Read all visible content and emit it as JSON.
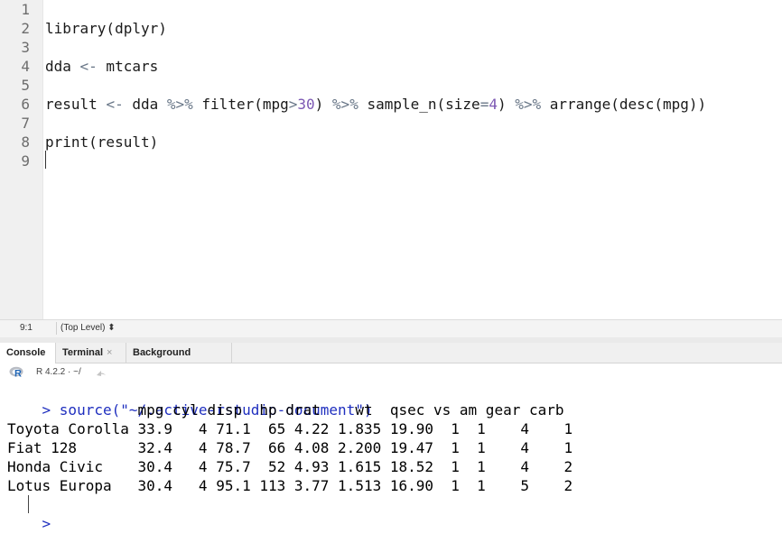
{
  "editor": {
    "line_numbers": [
      "1",
      "2",
      "3",
      "4",
      "5",
      "6",
      "7",
      "8",
      "9"
    ],
    "lines": [
      {
        "parts": []
      },
      {
        "parts": [
          {
            "t": "library(dplyr)",
            "c": "kw"
          }
        ]
      },
      {
        "parts": []
      },
      {
        "parts": [
          {
            "t": "dda ",
            "c": "kw"
          },
          {
            "t": "<-",
            "c": "op"
          },
          {
            "t": " mtcars",
            "c": "kw"
          }
        ]
      },
      {
        "parts": []
      },
      {
        "parts": [
          {
            "t": "result ",
            "c": "kw"
          },
          {
            "t": "<-",
            "c": "op"
          },
          {
            "t": " dda ",
            "c": "kw"
          },
          {
            "t": "%>%",
            "c": "op"
          },
          {
            "t": " filter(mpg",
            "c": "kw"
          },
          {
            "t": ">",
            "c": "op"
          },
          {
            "t": "30",
            "c": "num"
          },
          {
            "t": ") ",
            "c": "kw"
          },
          {
            "t": "%>%",
            "c": "op"
          },
          {
            "t": " sample_n(size",
            "c": "kw"
          },
          {
            "t": "=",
            "c": "op"
          },
          {
            "t": "4",
            "c": "num"
          },
          {
            "t": ") ",
            "c": "kw"
          },
          {
            "t": "%>%",
            "c": "op"
          },
          {
            "t": " arrange(desc(mpg))",
            "c": "kw"
          }
        ]
      },
      {
        "parts": []
      },
      {
        "parts": [
          {
            "t": "print(result)",
            "c": "kw"
          }
        ]
      },
      {
        "parts": []
      }
    ]
  },
  "status": {
    "position": "9:1",
    "scope": "(Top Level) ⬍"
  },
  "tabs": [
    {
      "label": "Console",
      "closable": false,
      "active": true
    },
    {
      "label": "Terminal",
      "closable": true,
      "active": false
    },
    {
      "label": "Background Jobs",
      "closable": true,
      "active": false
    }
  ],
  "console_header": {
    "r_version": "R 4.2.2 · ~/"
  },
  "console": {
    "prompt": "> ",
    "command": "source(\"~/.active-rstudio-document\")",
    "output_lines": [
      "               mpg cyl disp  hp drat    wt  qsec vs am gear carb",
      "Toyota Corolla 33.9   4 71.1  65 4.22 1.835 19.90  1  1    4    1",
      "Fiat 128       32.4   4 78.7  66 4.08 2.200 19.47  1  1    4    1",
      "Honda Civic    30.4   4 75.7  52 4.93 1.615 18.52  1  1    4    2",
      "Lotus Europa   30.4   4 95.1 113 3.77 1.513 16.90  1  1    5    2"
    ],
    "final_prompt": ">"
  },
  "colors": {
    "prompt": "#1f2fbf",
    "operator": "#687687",
    "number": "#7c58b3"
  }
}
